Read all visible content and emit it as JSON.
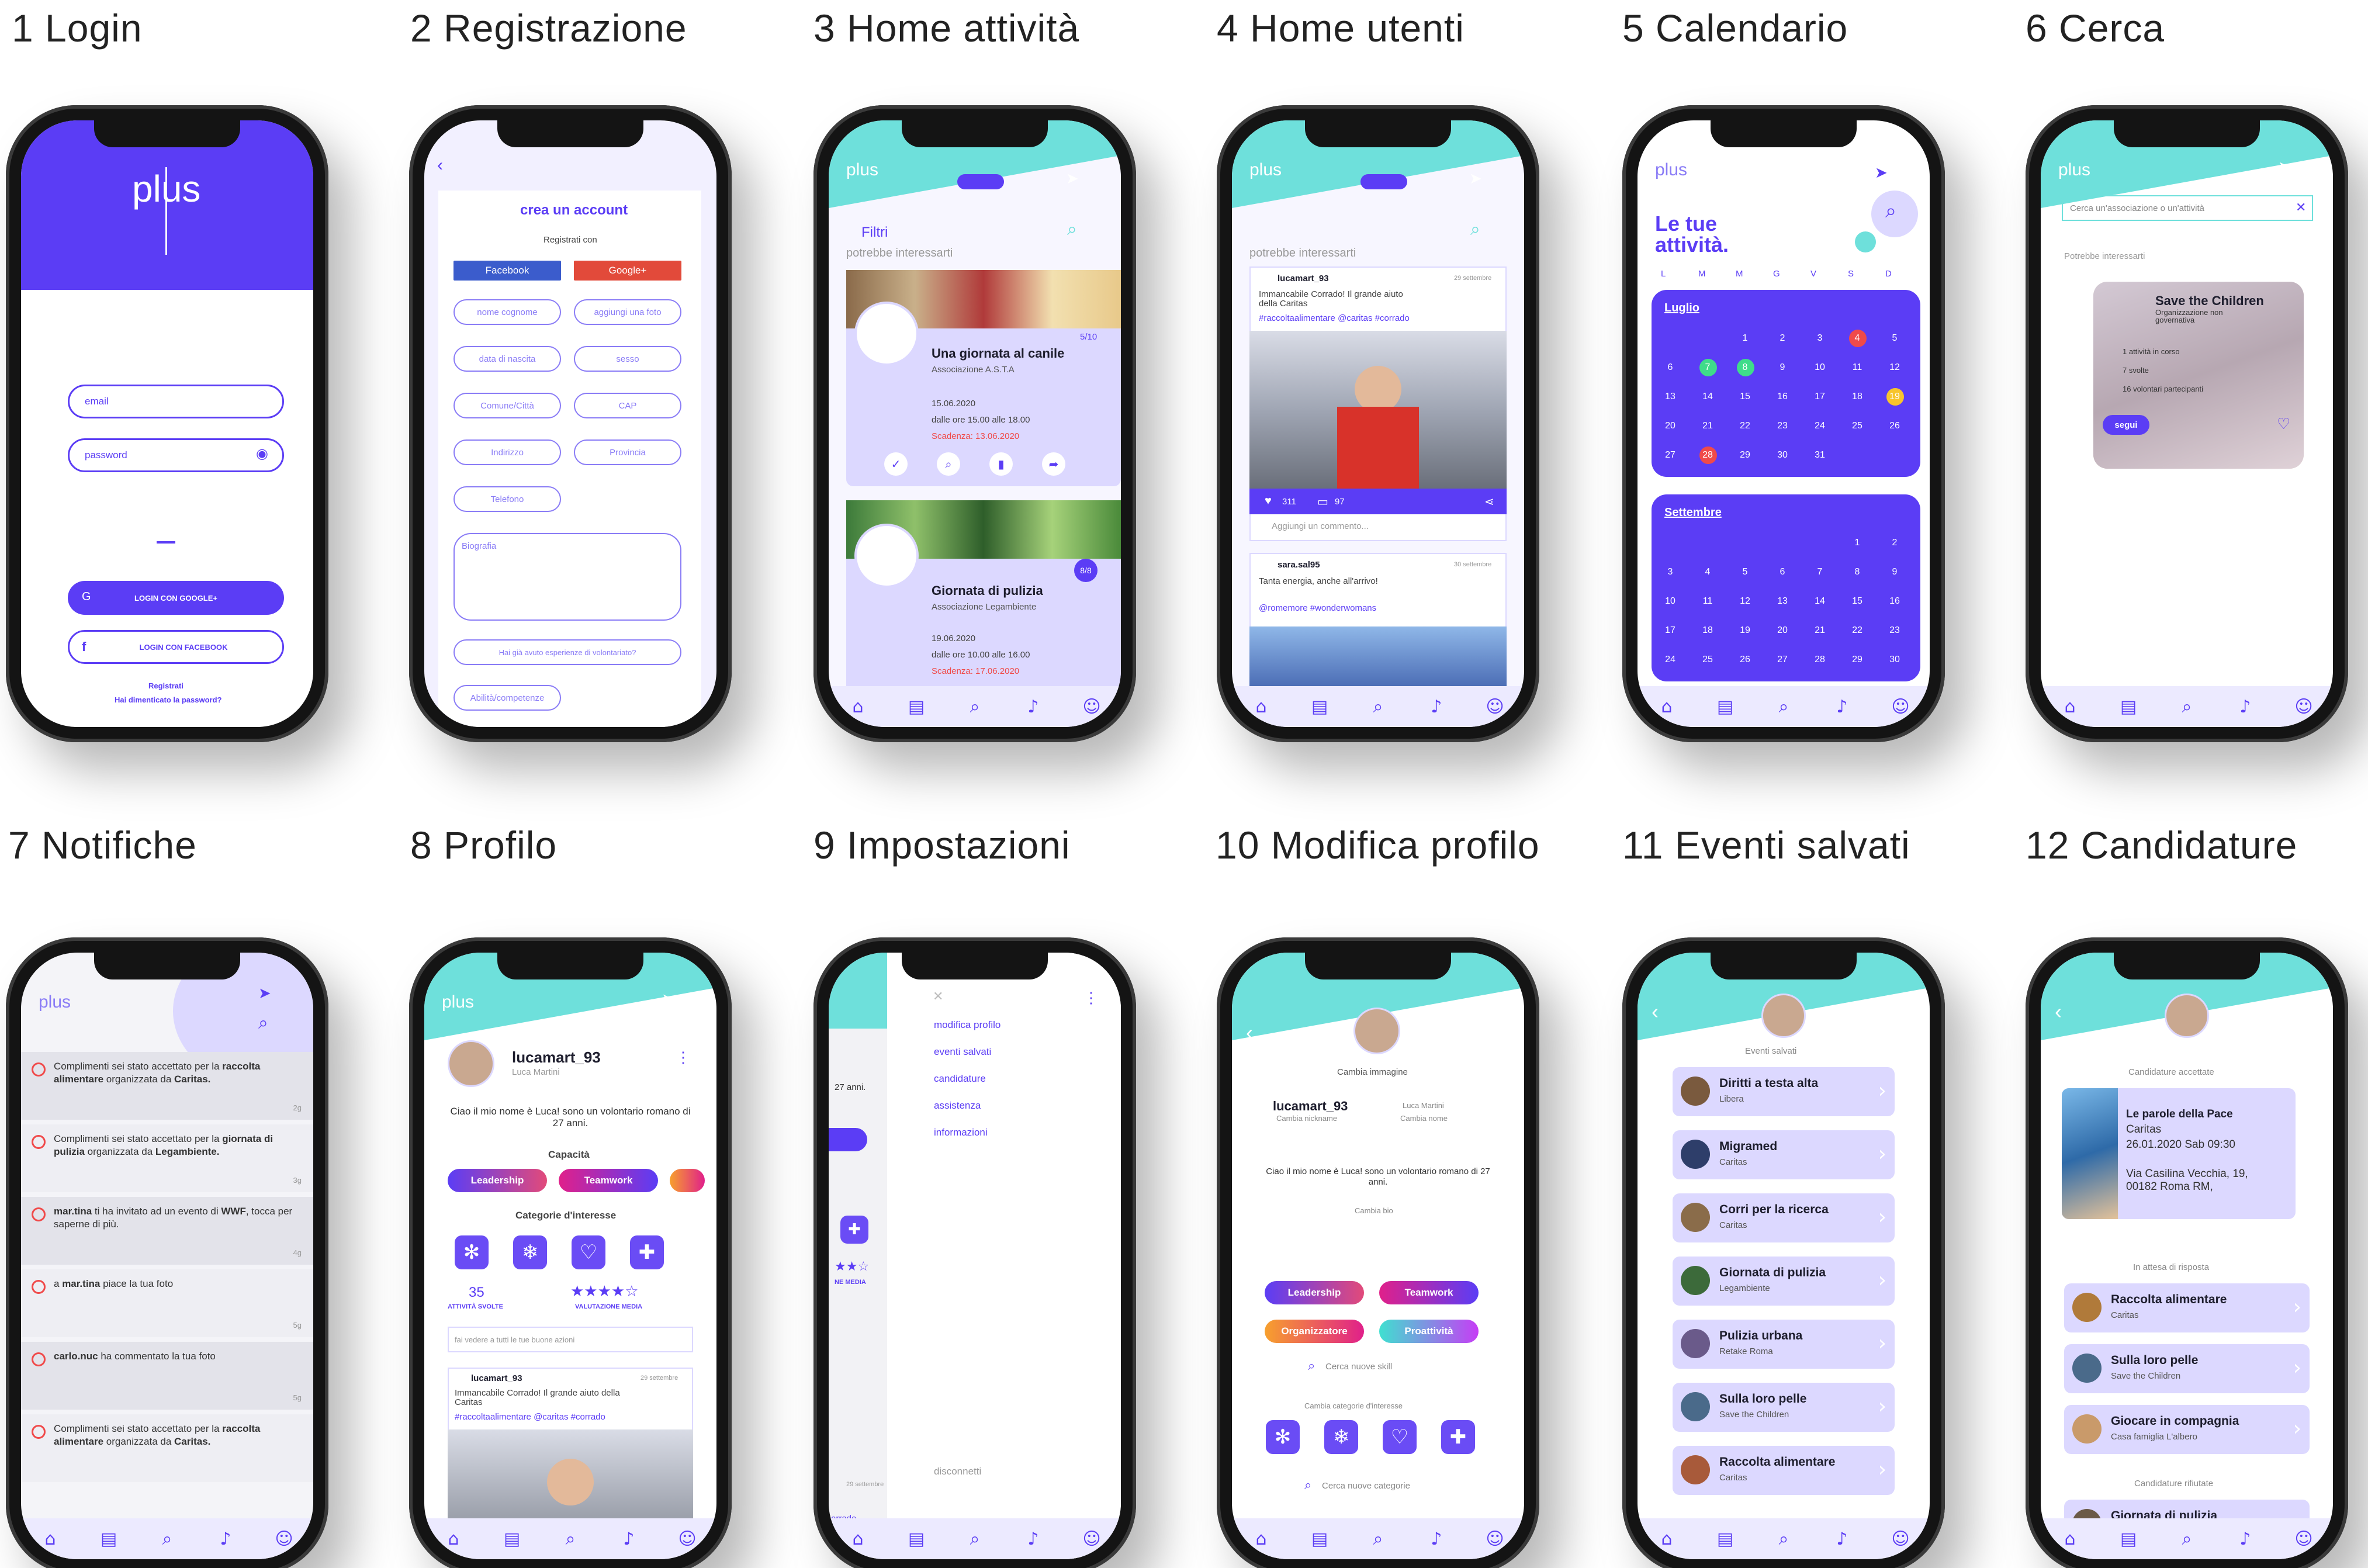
{
  "colors": {
    "accent": "#5b3df5",
    "teal": "#6ee0db",
    "lavender": "#dcd8ff",
    "alert": "#f04a4a",
    "green": "#3fdc8a",
    "yellow": "#f7c52d"
  },
  "captions": [
    "1 Login",
    "2 Registrazione",
    "3 Home attività",
    "4 Home utenti",
    "5 Calendario",
    "6 Cerca",
    "7 Notifiche",
    "8 Profilo",
    "9 Impostazioni",
    "10 Modifica profilo",
    "11 Eventi salvati",
    "12 Candidature"
  ],
  "logo": "plus",
  "nav_icons": [
    "home-icon",
    "calendar-icon",
    "search-icon",
    "bell-icon",
    "profile-icon"
  ],
  "login": {
    "email_placeholder": "email",
    "password_placeholder": "password",
    "google_button": "LOGIN CON GOOGLE+",
    "facebook_button": "LOGIN CON FACEBOOK",
    "register_link": "Registrati",
    "forgot_link": "Hai dimenticato la password?"
  },
  "registration": {
    "title": "crea un account",
    "register_with": "Registrati con",
    "facebook": "Facebook",
    "google": "Google+",
    "fields": [
      "nome cognome",
      "aggiungi una foto",
      "data di nascita",
      "sesso",
      "Comune/Città",
      "CAP",
      "Indirizzo",
      "Provincia",
      "Telefono"
    ],
    "bio": "Biografia",
    "experience": "Hai già avuto esperienze di volontariato?",
    "skills": "Abilità/competenze"
  },
  "home_activities": {
    "filters": "Filtri",
    "suggestions": "potrebbe interessarti",
    "events": [
      {
        "title": "Una giornata al canile",
        "org": "Associazione A.S.T.A",
        "date": "15.06.2020",
        "time": "dalle ore 15.00 alle 18.00",
        "deadline": "Scadenza: 13.06.2020",
        "count": "5/10"
      },
      {
        "title": "Giornata di pulizia",
        "org": "Associazione Legambiente",
        "date": "19.06.2020",
        "time": "dalle ore 10.00 alle 16.00",
        "deadline": "Scadenza: 17.06.2020",
        "count": "8/8"
      }
    ]
  },
  "home_users": {
    "suggestions": "potrebbe interessarti",
    "post1": {
      "user": "lucamart_93",
      "date": "29 settembre",
      "text": "Immancabile Corrado! Il grande aiuto della Caritas",
      "tags": "#raccoltaalimentare @caritas #corrado",
      "likes": "311",
      "comments": "97",
      "comment_placeholder": "Aggiungi un commento..."
    },
    "post2": {
      "user": "sara.sal95",
      "date": "30 settembre",
      "text": "Tanta energia, anche all'arrivo!",
      "tags": "@romemore #wonderwomans"
    }
  },
  "calendar": {
    "title_line1": "Le tue",
    "title_line2": "attività.",
    "weekdays": [
      "L",
      "M",
      "M",
      "G",
      "V",
      "S",
      "D"
    ],
    "months": [
      {
        "name": "Luglio",
        "rows": [
          [
            "",
            "",
            "1",
            "2",
            "3",
            "4",
            "5"
          ],
          [
            "6",
            "7",
            "8",
            "9",
            "10",
            "11",
            "12"
          ],
          [
            "13",
            "14",
            "15",
            "16",
            "17",
            "18",
            "19"
          ],
          [
            "20",
            "21",
            "22",
            "23",
            "24",
            "25",
            "26"
          ],
          [
            "27",
            "28",
            "29",
            "30",
            "31",
            "",
            ""
          ]
        ]
      },
      {
        "name": "Settembre",
        "rows": [
          [
            "",
            "",
            "",
            "",
            "",
            "1",
            "2"
          ],
          [
            "3",
            "4",
            "5",
            "6",
            "7",
            "8",
            "9"
          ],
          [
            "10",
            "11",
            "12",
            "13",
            "14",
            "15",
            "16"
          ],
          [
            "17",
            "18",
            "19",
            "20",
            "21",
            "22",
            "23"
          ],
          [
            "24",
            "25",
            "26",
            "27",
            "28",
            "29",
            "30"
          ]
        ]
      }
    ]
  },
  "search": {
    "placeholder": "Cerca un'associazione o un'attività",
    "suggestions": "Potrebbe interessarti",
    "card": {
      "title": "Save the Children",
      "subtitle": "Organizzazione non governativa",
      "stat1": "1 attività in corso",
      "stat2": "7 svolte",
      "stat3": "16 volontari partecipanti",
      "follow": "segui"
    }
  },
  "notifications": [
    {
      "pre": "Complimenti sei stato accettato per la ",
      "bold": "raccolta alimentare",
      "mid": " organizzata da ",
      "org": "Caritas.",
      "age": "2g"
    },
    {
      "pre": "Complimenti sei stato accettato per la ",
      "bold": "giornata di pulizia",
      "mid": " organizzata da ",
      "org": "Legambiente.",
      "age": "3g"
    },
    {
      "pre": "",
      "bold": "mar.tina",
      "mid": " ti ha invitato ad un evento di ",
      "org": "WWF",
      "tail": ", tocca per saperne di più.",
      "age": "4g"
    },
    {
      "pre": "a ",
      "bold": "mar.tina",
      "mid": " piace la tua foto",
      "org": "",
      "age": "5g"
    },
    {
      "pre": "",
      "bold": "carlo.nuc",
      "mid": " ha commentato la tua foto",
      "org": "",
      "age": "5g"
    },
    {
      "pre": "Complimenti sei stato accettato per la ",
      "bold": "raccolta alimentare",
      "mid": " organizzata da ",
      "org": "Caritas.",
      "age": ""
    }
  ],
  "profile": {
    "username": "lucamart_93",
    "name": "Luca Martini",
    "bio": "Ciao il mio nome è Luca! sono un volontario romano di 27 anni.",
    "skills_title": "Capacità",
    "skills": [
      "Leadership",
      "Teamwork"
    ],
    "interests_title": "Categorie d'interesse",
    "activities_count": "35",
    "activities_label": "ATTIVITÀ SVOLTE",
    "rating_label": "VALUTAZIONE MEDIA",
    "rating": 4,
    "post_placeholder": "fai vedere a tutti le tue buone azioni",
    "post": {
      "user": "lucamart_93",
      "date": "29 settembre",
      "text": "Immancabile Corrado! Il grande aiuto della Caritas",
      "tags": "#raccoltaalimentare @caritas #corrado"
    }
  },
  "settings": {
    "menu": [
      "modifica profilo",
      "eventi salvati",
      "candidature",
      "assistenza",
      "informazioni"
    ],
    "logout": "disconnetti",
    "peek_text": "27 anni.",
    "peek_media": "NE MEDIA",
    "peek_date": "29 settembre",
    "peek_tag": "orrado"
  },
  "edit_profile": {
    "change_image": "Cambia immagine",
    "username": "lucamart_93",
    "name": "Luca Martini",
    "change_nickname": "Cambia nickname",
    "change_name": "Cambia nome",
    "bio": "Ciao il mio nome è Luca! sono un volontario romano di 27 anni.",
    "change_bio": "Cambia bio",
    "skills": [
      "Leadership",
      "Teamwork",
      "Organizzatore",
      "Proattività"
    ],
    "search_skills": "Cerca nuove skill",
    "change_categories": "Cambia categorie d'interesse",
    "search_categories": "Cerca nuove categorie"
  },
  "saved_events": {
    "title": "Eventi salvati",
    "items": [
      {
        "title": "Diritti a testa alta",
        "org": "Libera"
      },
      {
        "title": "Migramed",
        "org": "Caritas"
      },
      {
        "title": "Corri per la ricerca",
        "org": "Caritas"
      },
      {
        "title": "Giornata di pulizia",
        "org": "Legambiente"
      },
      {
        "title": "Pulizia urbana",
        "org": "Retake Roma"
      },
      {
        "title": "Sulla loro pelle",
        "org": "Save the Children"
      },
      {
        "title": "Raccolta alimentare",
        "org": "Caritas"
      }
    ]
  },
  "applications": {
    "accepted_title": "Candidature accettate",
    "accepted": {
      "title": "Le parole della Pace",
      "org": "Caritas",
      "date": "26.01.2020 Sab 09:30",
      "address": "Via Casilina Vecchia, 19, 00182 Roma RM,"
    },
    "pending_title": "In attesa di risposta",
    "pending": [
      {
        "title": "Raccolta alimentare",
        "org": "Caritas"
      },
      {
        "title": "Sulla loro pelle",
        "org": "Save the Children"
      },
      {
        "title": "Giocare in compagnia",
        "org": "Casa famiglia L'albero"
      }
    ],
    "rejected_title": "Candidature rifiutate",
    "rejected": [
      {
        "title": "Giornata di pulizia"
      }
    ]
  }
}
